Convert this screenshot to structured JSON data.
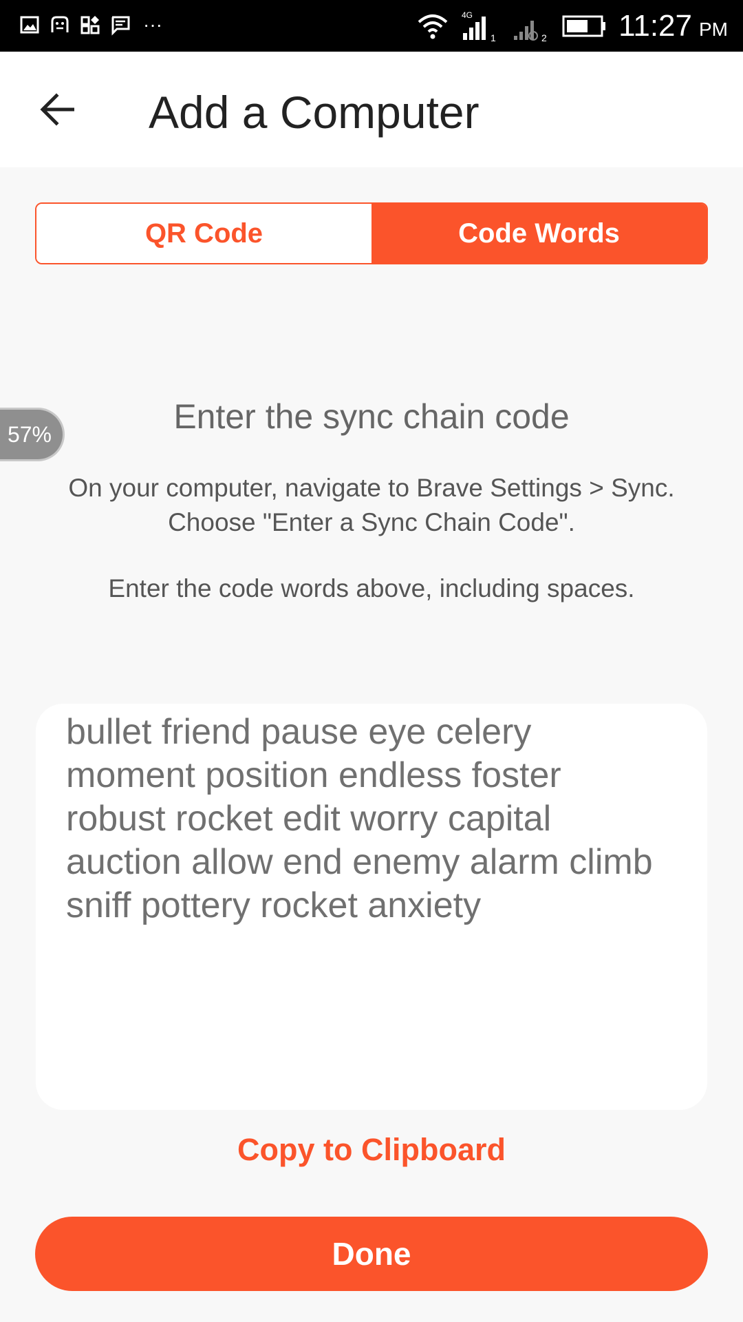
{
  "status_bar": {
    "time": "11:27",
    "ampm": "PM",
    "network_label": "4G",
    "sim1_label": "1",
    "sim2_label": "2",
    "notification_icons": [
      "gallery-icon",
      "app-icon",
      "widgets-icon",
      "message-icon"
    ],
    "more_label": "···"
  },
  "app_bar": {
    "title": "Add a Computer",
    "back_icon": "arrow-left-icon"
  },
  "tabs": [
    {
      "label": "QR Code",
      "active": false
    },
    {
      "label": "Code Words",
      "active": true
    }
  ],
  "zoom_badge": "57%",
  "heading": "Enter the sync chain code",
  "instructions": "On your computer, navigate to Brave Settings > Sync. Choose \"Enter a Sync Chain Code\".",
  "instructions_2": "Enter the code words above, including spaces.",
  "code_words": "bullet friend pause eye celery\nmoment position endless foster\nrobust rocket edit worry capital\nauction allow end enemy alarm climb\nsniff pottery rocket anxiety",
  "copy_label": "Copy to Clipboard",
  "done_label": "Done",
  "colors": {
    "accent": "#fb542b",
    "status_bar": "#000000",
    "background": "#f8f8f8"
  }
}
